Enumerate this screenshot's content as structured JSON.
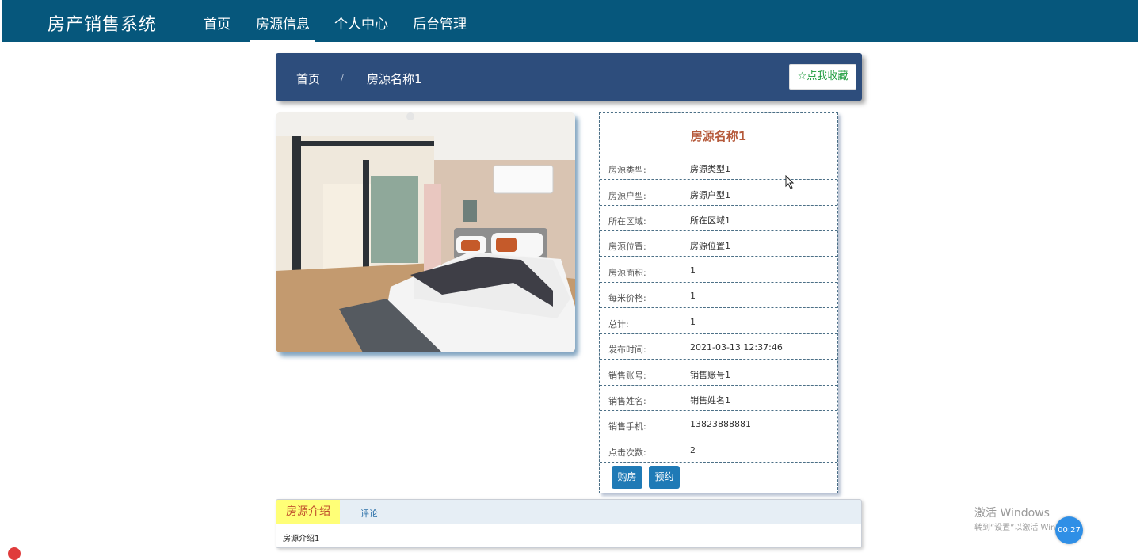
{
  "nav": {
    "brand": "房产销售系统",
    "items": [
      {
        "label": "首页"
      },
      {
        "label": "房源信息",
        "active": true
      },
      {
        "label": "个人中心"
      },
      {
        "label": "后台管理"
      }
    ],
    "color": "#06577c"
  },
  "breadcrumb": {
    "home": "首页",
    "separator": "/",
    "current": "房源名称1",
    "favorite_label": "☆点我收藏",
    "color": "#2d4d7c"
  },
  "details": {
    "title": "房源名称1",
    "rows": [
      {
        "label": "房源类型:",
        "value": "房源类型1"
      },
      {
        "label": "房源户型:",
        "value": "房源户型1"
      },
      {
        "label": "所在区域:",
        "value": "所在区域1"
      },
      {
        "label": "房源位置:",
        "value": "房源位置1"
      },
      {
        "label": "房源面积:",
        "value": "1"
      },
      {
        "label": "每米价格:",
        "value": "1"
      },
      {
        "label": "总计:",
        "value": "1"
      },
      {
        "label": "发布时间:",
        "value": "2021-03-13 12:37:46"
      },
      {
        "label": "销售账号:",
        "value": "销售账号1"
      },
      {
        "label": "销售姓名:",
        "value": "销售姓名1"
      },
      {
        "label": "销售手机:",
        "value": "13823888881"
      },
      {
        "label": "点击次数:",
        "value": "2"
      }
    ],
    "buttons": {
      "buy": "购房",
      "reserve": "预约"
    },
    "button_color": "#1f7ab6"
  },
  "tabs": {
    "intro_label": "房源介绍",
    "comments_label": "评论",
    "intro_content": "房源介绍1"
  },
  "watermark": {
    "line1": "激活 Windows",
    "line2": "转到“设置”以激活 Windows。",
    "timer": "00:27"
  }
}
